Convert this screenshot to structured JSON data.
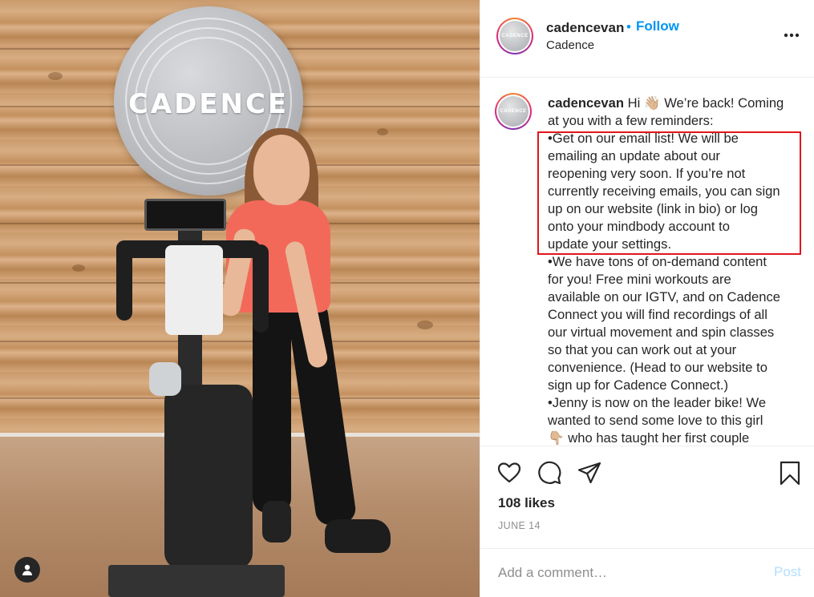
{
  "photo": {
    "sign_text": "CADENCE"
  },
  "header": {
    "username": "cadencevan",
    "follow_separator": "•",
    "follow_label": "Follow",
    "location": "Cadence",
    "avatar_text": "CADENCE",
    "more_icon": "more-options-icon"
  },
  "caption": {
    "username": "cadencevan",
    "lines": [
      "Hi 👋🏼 We’re back! Coming",
      "at you with a few reminders:",
      "•Get on our email list! We will be",
      "emailing an update about our",
      "reopening very soon. If you’re not",
      "currently receiving emails, you can sign",
      "up on our website (link in bio) or log",
      "onto your mindbody account to",
      "update your settings.",
      "•We have tons of on-demand content",
      "for you! Free mini workouts are",
      "available on our IGTV, and on Cadence",
      "Connect you will find recordings of all",
      "our virtual movement and spin classes",
      "so that you can work out at your",
      "convenience. (Head to our website to",
      "sign up for Cadence Connect.)",
      "•Jenny is now on the leader bike! We",
      "wanted to send some love to this girl",
      "👇🏼 who has taught her first couple"
    ]
  },
  "actions": {
    "icons": [
      "heart-icon",
      "comment-icon",
      "share-icon",
      "bookmark-icon"
    ],
    "likes": "108 likes",
    "date": "JUNE 14"
  },
  "comment": {
    "placeholder": "Add a comment…",
    "post_label": "Post"
  },
  "colors": {
    "link_blue": "#0095f6",
    "post_disabled": "#b2dffc",
    "highlight_red": "#e2151b",
    "muted_text": "#8e8e8e"
  }
}
